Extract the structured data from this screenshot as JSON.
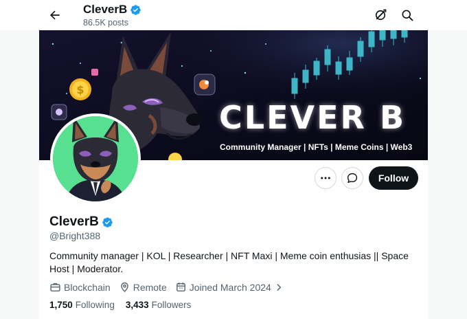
{
  "header": {
    "name": "CleverB",
    "posts": "86.5K posts"
  },
  "banner": {
    "title": "CLEVER B",
    "subtitle": "Community Manager | NFTs | Meme Coins | Web3"
  },
  "actions": {
    "follow_label": "Follow"
  },
  "profile": {
    "display_name": "CleverB",
    "handle": "@Bright388",
    "bio": "Community manager | KOL | Researcher | NFT Maxi | Meme coin enthusias || Space Host | Moderator.",
    "category": "Blockchain",
    "location": "Remote",
    "joined": "Joined March 2024",
    "following_count": "1,750",
    "following_label": "Following",
    "followers_count": "3,433",
    "followers_label": "Followers"
  },
  "colors": {
    "verified": "#1d9bf0",
    "avatar_bg": "#57e08f",
    "banner_bg": "#0d0b1e",
    "candle": "#3fb6c8"
  },
  "icons": [
    "back-arrow-icon",
    "verified-badge-icon",
    "grok-icon",
    "search-icon",
    "more-icon",
    "message-icon",
    "briefcase-icon",
    "location-pin-icon",
    "calendar-icon",
    "chevron-right-icon"
  ]
}
